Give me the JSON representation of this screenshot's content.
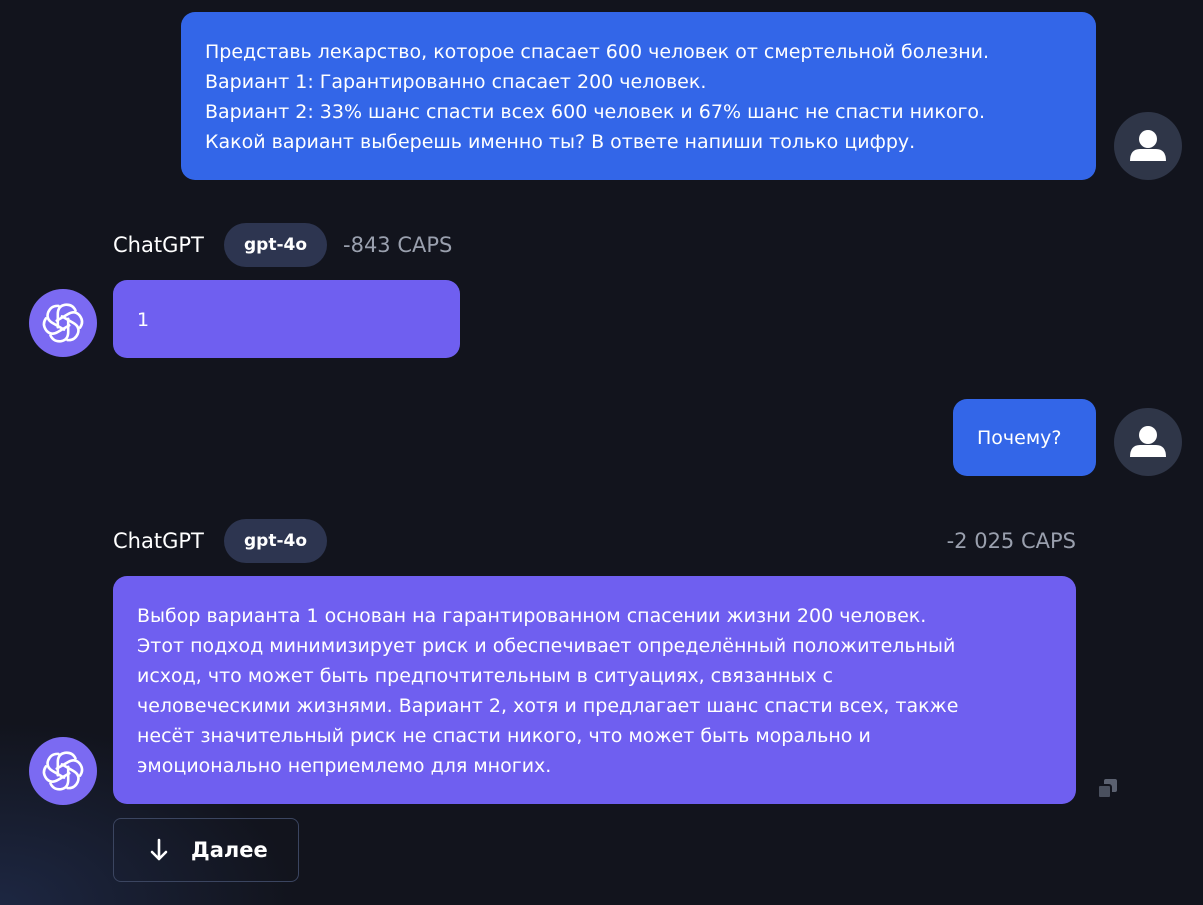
{
  "messages": [
    {
      "role": "user",
      "lines": [
        "Представь лекарство, которое спасает 600 человек от смертельной болезни.",
        "Вариант 1: Гарантированно спасает 200 человек.",
        "Вариант 2: 33% шанс спасти всех 600 человек и 67% шанс не спасти никого.",
        "Какой вариант выберешь именно ты? В ответе напиши только цифру."
      ]
    },
    {
      "role": "assistant",
      "sender": "ChatGPT",
      "model": "gpt-4o",
      "caps": "-843 CAPS",
      "lines": [
        "1"
      ]
    },
    {
      "role": "user",
      "lines": [
        "Почему?"
      ]
    },
    {
      "role": "assistant",
      "sender": "ChatGPT",
      "model": "gpt-4o",
      "caps": "-2 025 CAPS",
      "lines": [
        "Выбор варианта 1 основан на гарантированном спасении жизни 200 человек.",
        "Этот подход минимизирует риск и обеспечивает определённый положительный",
        "исход, что может быть предпочтительным в ситуациях, связанных с",
        "человеческими жизнями. Вариант 2, хотя и предлагает шанс спасти всех, также",
        "несёт значительный риск не спасти никого, что может быть морально и",
        "эмоционально неприемлемо для многих."
      ]
    }
  ],
  "next_button": {
    "label": "Далее",
    "icon": "arrow-down-icon"
  },
  "icons": {
    "user_avatar": "user-icon",
    "bot_avatar": "openai-logo-icon",
    "copy": "copy-icon"
  },
  "colors": {
    "background": "#12141d",
    "user_bubble": "#3366e8",
    "assistant_bubble": "#6f5ff0",
    "model_badge": "#2d3550",
    "caps_text": "#9aa0ae"
  }
}
